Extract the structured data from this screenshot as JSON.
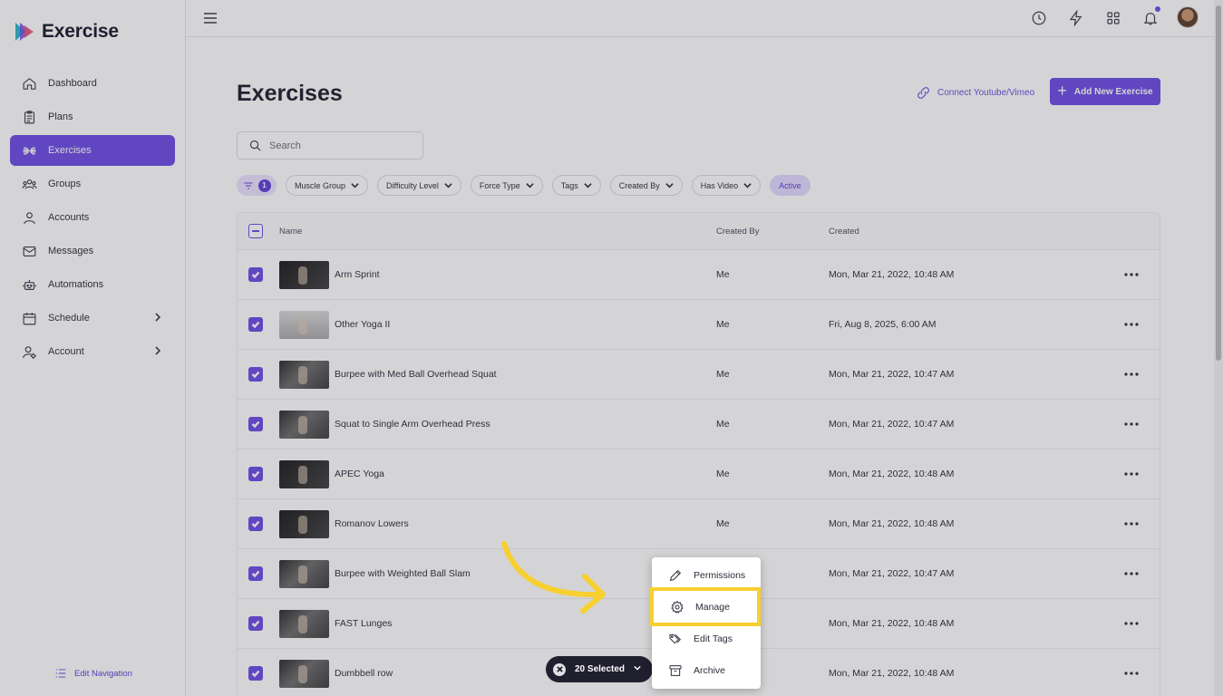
{
  "app": {
    "name": "Exercise"
  },
  "sidebar": {
    "items": [
      {
        "label": "Dashboard",
        "icon": "home-icon"
      },
      {
        "label": "Plans",
        "icon": "clipboard-icon"
      },
      {
        "label": "Exercises",
        "icon": "dumbbell-icon",
        "active": true
      },
      {
        "label": "Groups",
        "icon": "groups-icon"
      },
      {
        "label": "Accounts",
        "icon": "user-icon"
      },
      {
        "label": "Messages",
        "icon": "mail-icon"
      },
      {
        "label": "Automations",
        "icon": "robot-icon"
      },
      {
        "label": "Schedule",
        "icon": "calendar-icon",
        "expandable": true
      },
      {
        "label": "Account",
        "icon": "user-settings-icon",
        "expandable": true
      }
    ],
    "edit_navigation": "Edit Navigation"
  },
  "header": {
    "icons": [
      "history-icon",
      "bolt-icon",
      "grid-icon",
      "bell-icon"
    ]
  },
  "page": {
    "title": "Exercises",
    "connect_link": "Connect Youtube/Vimeo",
    "add_button": "Add New Exercise",
    "search_placeholder": "Search"
  },
  "filters": {
    "active_count": "1",
    "chips": [
      "Muscle Group",
      "Difficulty Level",
      "Force Type",
      "Tags",
      "Created By",
      "Has Video"
    ],
    "status_chip": "Active"
  },
  "table": {
    "columns": {
      "name": "Name",
      "created_by": "Created By",
      "created": "Created"
    },
    "rows": [
      {
        "name": "Arm Sprint",
        "created_by": "Me",
        "created": "Mon, Mar 21, 2022, 10:48 AM"
      },
      {
        "name": "Other Yoga II",
        "created_by": "Me",
        "created": "Fri, Aug 8, 2025, 6:00 AM"
      },
      {
        "name": "Burpee with Med Ball Overhead Squat",
        "created_by": "Me",
        "created": "Mon, Mar 21, 2022, 10:47 AM"
      },
      {
        "name": "Squat to Single Arm Overhead Press",
        "created_by": "Me",
        "created": "Mon, Mar 21, 2022, 10:47 AM"
      },
      {
        "name": "APEC Yoga",
        "created_by": "Me",
        "created": "Mon, Mar 21, 2022, 10:48 AM"
      },
      {
        "name": "Romanov Lowers",
        "created_by": "Me",
        "created": "Mon, Mar 21, 2022, 10:48 AM"
      },
      {
        "name": "Burpee with Weighted Ball Slam",
        "created_by": "",
        "created": "Mon, Mar 21, 2022, 10:47 AM"
      },
      {
        "name": "FAST Lunges",
        "created_by": "",
        "created": "Mon, Mar 21, 2022, 10:48 AM"
      },
      {
        "name": "Dumbbell row",
        "created_by": "",
        "created": "Mon, Mar 21, 2022, 10:48 AM"
      }
    ]
  },
  "selection": {
    "label": "20 Selected"
  },
  "bulk_menu": {
    "items": [
      {
        "label": "Permissions",
        "icon": "pencil-icon"
      },
      {
        "label": "Manage",
        "icon": "gear-icon",
        "highlighted": true
      },
      {
        "label": "Edit Tags",
        "icon": "tags-icon"
      },
      {
        "label": "Archive",
        "icon": "archive-icon"
      }
    ]
  },
  "colors": {
    "accent": "#6b4be5",
    "highlight": "#f7cf2f"
  }
}
